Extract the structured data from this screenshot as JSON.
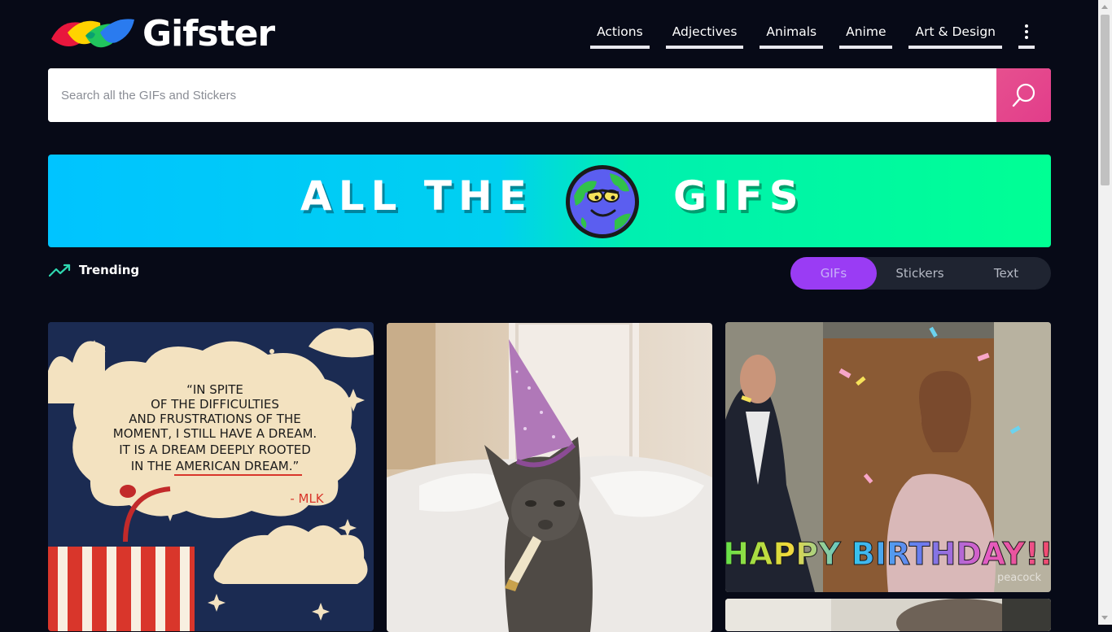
{
  "app": {
    "name": "Gifster"
  },
  "nav": {
    "items": [
      {
        "label": "Actions"
      },
      {
        "label": "Adjectives"
      },
      {
        "label": "Animals"
      },
      {
        "label": "Anime"
      },
      {
        "label": "Art & Design"
      }
    ],
    "more_icon": "vertical-ellipsis-icon"
  },
  "search": {
    "placeholder": "Search all the GIFs and Stickers",
    "value": "",
    "icon": "search-icon"
  },
  "banner": {
    "left_text": "ALL THE",
    "right_text": "GIFS",
    "icon": "globe-character"
  },
  "trending": {
    "label": "Trending",
    "icon": "trending-up-icon"
  },
  "tabs": [
    {
      "label": "GIFs",
      "active": true
    },
    {
      "label": "Stickers",
      "active": false
    },
    {
      "label": "Text",
      "active": false
    }
  ],
  "tiles": {
    "quote": {
      "lines": [
        "“IN SPITE",
        "OF THE DIFFICULTIES",
        "AND FRUSTRATIONS OF THE",
        "MOMENT, I STILL HAVE A DREAM.",
        "IT IS A DREAM DEEPLY ROOTED",
        "IN THE AMERICAN DREAM.”"
      ],
      "signature": "- MLK"
    },
    "cat": {
      "subject": "cat in party hat"
    },
    "birthday": {
      "caption": "HAPPY BIRTHDAY!!",
      "watermark": "peacock"
    }
  },
  "colors": {
    "accent_pink": "#e6508f",
    "tab_active": "#9a3cf4",
    "background": "#070a17",
    "trending": "#2fd8b0"
  }
}
